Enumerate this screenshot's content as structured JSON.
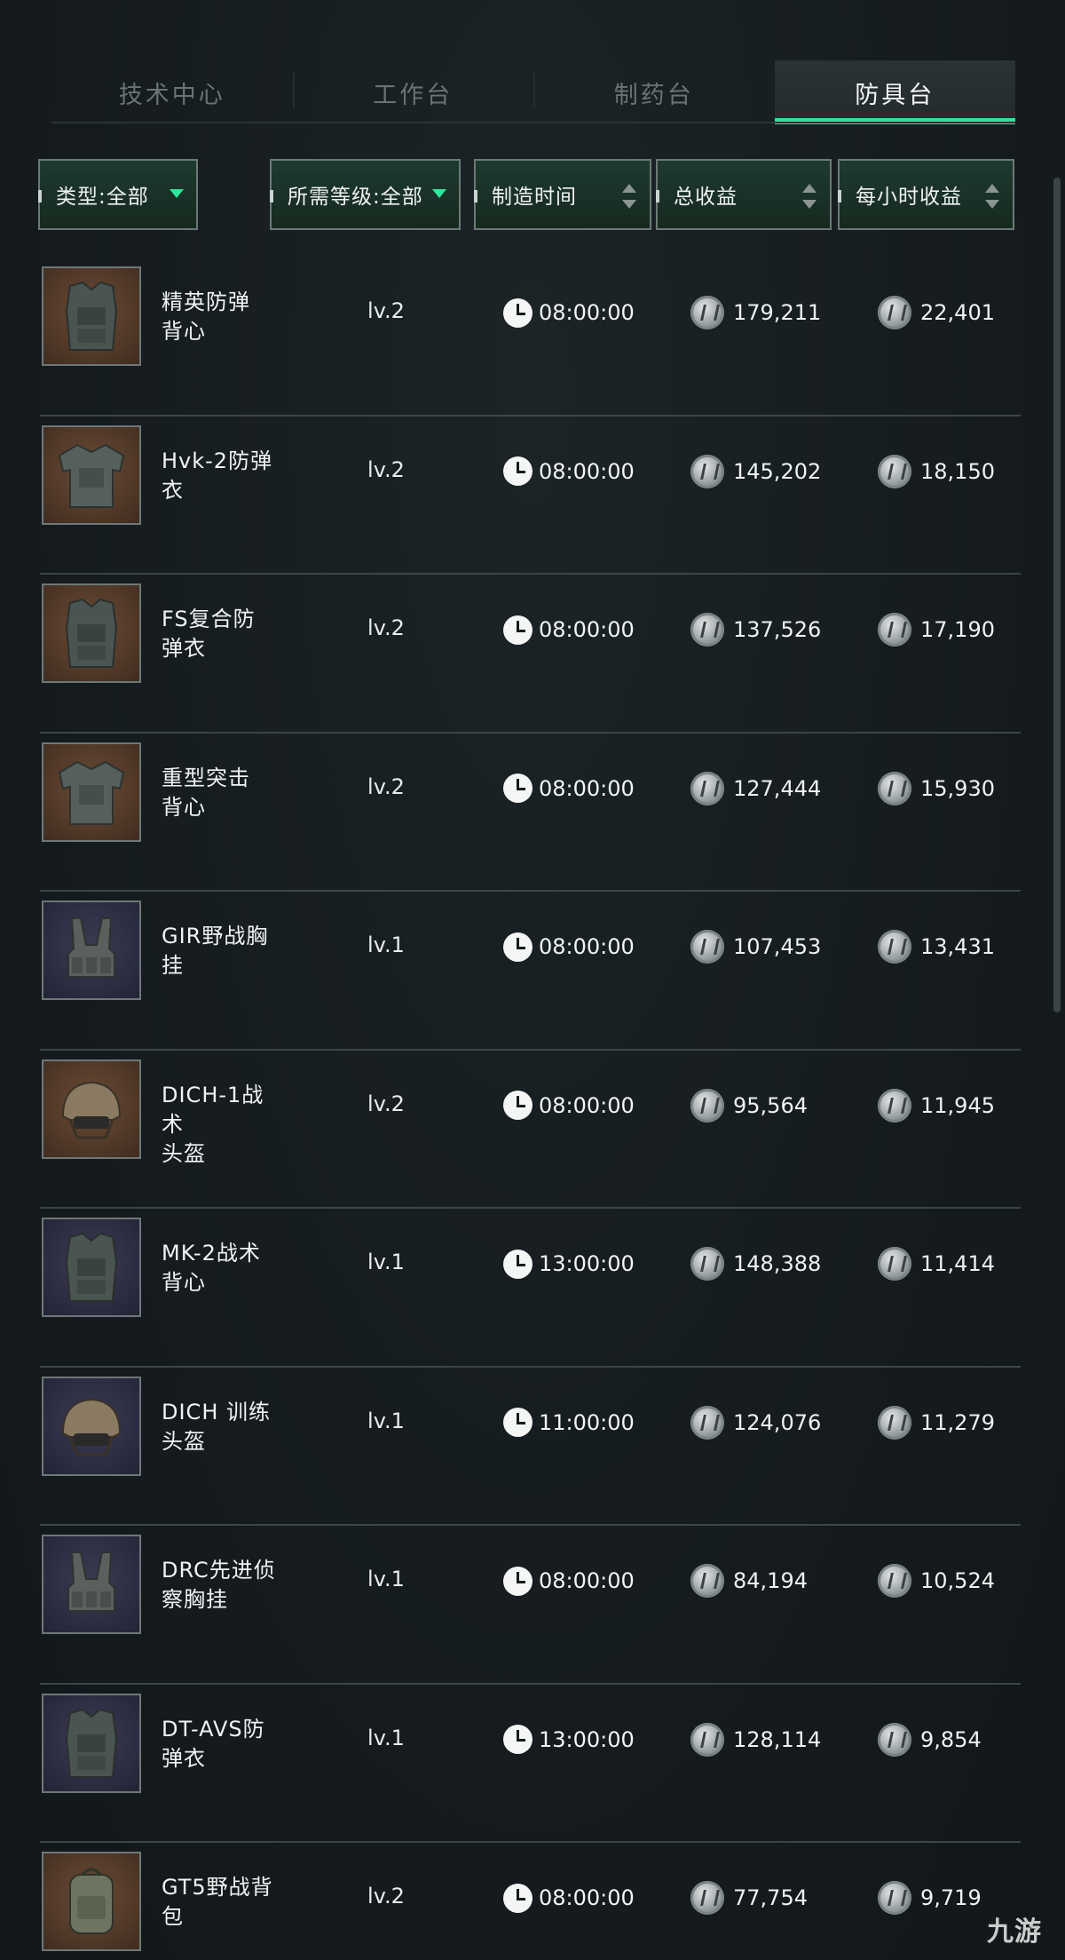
{
  "tabs": [
    {
      "label": "技术中心",
      "active": false
    },
    {
      "label": "工作台",
      "active": false
    },
    {
      "label": "制药台",
      "active": false
    },
    {
      "label": "防具台",
      "active": true
    }
  ],
  "filters": {
    "type": "类型:全部",
    "level": "所需等级:全部",
    "time": "制造时间",
    "total": "总收益",
    "hourly": "每小时收益"
  },
  "colors": {
    "accent": "#2fe39a",
    "background": "#161c1f",
    "row_divider": "#3c4649"
  },
  "items": [
    {
      "name_l1": "精英防弹",
      "name_l2": "背心",
      "level": "lv.2",
      "time": "08:00:00",
      "total": "179,211",
      "hourly": "22,401",
      "thumb_bg": "brown",
      "icon": "vest-icon"
    },
    {
      "name_l1": "Hvk-2防弹",
      "name_l2": "衣",
      "level": "lv.2",
      "time": "08:00:00",
      "total": "145,202",
      "hourly": "18,150",
      "thumb_bg": "brown",
      "icon": "armor-icon"
    },
    {
      "name_l1": "FS复合防",
      "name_l2": "弹衣",
      "level": "lv.2",
      "time": "08:00:00",
      "total": "137,526",
      "hourly": "17,190",
      "thumb_bg": "brown",
      "icon": "vest-icon"
    },
    {
      "name_l1": "重型突击",
      "name_l2": "背心",
      "level": "lv.2",
      "time": "08:00:00",
      "total": "127,444",
      "hourly": "15,930",
      "thumb_bg": "brown",
      "icon": "armor-icon"
    },
    {
      "name_l1": "GIR野战胸",
      "name_l2": "挂",
      "level": "lv.1",
      "time": "08:00:00",
      "total": "107,453",
      "hourly": "13,431",
      "thumb_bg": "purple",
      "icon": "chest-rig-icon"
    },
    {
      "name_l1": "DICH-1战术",
      "name_l2": "头盔",
      "level": "lv.2",
      "time": "08:00:00",
      "total": "95,564",
      "hourly": "11,945",
      "thumb_bg": "brown",
      "icon": "helmet-icon"
    },
    {
      "name_l1": "MK-2战术",
      "name_l2": "背心",
      "level": "lv.1",
      "time": "13:00:00",
      "total": "148,388",
      "hourly": "11,414",
      "thumb_bg": "purple",
      "icon": "vest-icon"
    },
    {
      "name_l1": "DICH 训练",
      "name_l2": "头盔",
      "level": "lv.1",
      "time": "11:00:00",
      "total": "124,076",
      "hourly": "11,279",
      "thumb_bg": "purple",
      "icon": "helmet-icon"
    },
    {
      "name_l1": "DRC先进侦",
      "name_l2": "察胸挂",
      "level": "lv.1",
      "time": "08:00:00",
      "total": "84,194",
      "hourly": "10,524",
      "thumb_bg": "purple",
      "icon": "chest-rig-icon"
    },
    {
      "name_l1": "DT-AVS防",
      "name_l2": "弹衣",
      "level": "lv.1",
      "time": "13:00:00",
      "total": "128,114",
      "hourly": "9,854",
      "thumb_bg": "purple",
      "icon": "vest-icon"
    },
    {
      "name_l1": "GT5野战背",
      "name_l2": "包",
      "level": "lv.2",
      "time": "08:00:00",
      "total": "77,754",
      "hourly": "9,719",
      "thumb_bg": "brown",
      "icon": "backpack-icon"
    }
  ],
  "watermark": "九游"
}
